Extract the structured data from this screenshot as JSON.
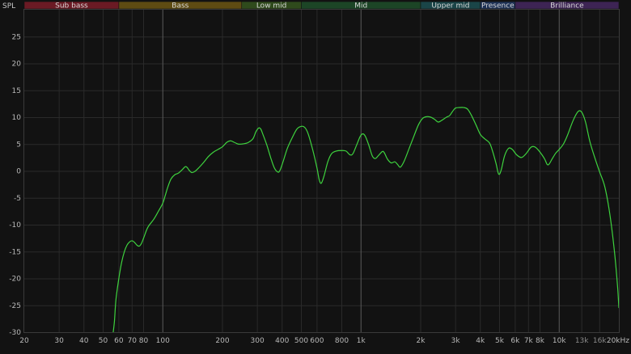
{
  "chart_data": {
    "type": "line",
    "ylabel": "SPL",
    "xscale": "log",
    "xlim": [
      20,
      20000
    ],
    "ylim": [
      -30,
      30
    ],
    "grid": true,
    "colors": {
      "background": "#121212",
      "grid": "#2a2a2a",
      "grid_major": "#5a5a5a",
      "line": "#3ed23e"
    },
    "bands": [
      {
        "name": "Sub bass",
        "from": 20,
        "to": 60,
        "color": "#6b1a24"
      },
      {
        "name": "Bass",
        "from": 60,
        "to": 250,
        "color": "#5e4b12"
      },
      {
        "name": "Low mid",
        "from": 250,
        "to": 500,
        "color": "#2f4a1c"
      },
      {
        "name": "Mid",
        "from": 500,
        "to": 2000,
        "color": "#1c4526"
      },
      {
        "name": "Upper mid",
        "from": 2000,
        "to": 4000,
        "color": "#1a4548"
      },
      {
        "name": "Presence",
        "from": 4000,
        "to": 6000,
        "color": "#1e3256"
      },
      {
        "name": "Brilliance",
        "from": 6000,
        "to": 20000,
        "color": "#3d2454"
      }
    ],
    "y_ticks": [
      {
        "label": "25",
        "value": 25
      },
      {
        "label": "20",
        "value": 20
      },
      {
        "label": "15",
        "value": 15
      },
      {
        "label": "10",
        "value": 10
      },
      {
        "label": "5",
        "value": 5
      },
      {
        "label": "0",
        "value": 0
      },
      {
        "label": "-5",
        "value": -5
      },
      {
        "label": "-10",
        "value": -10
      },
      {
        "label": "-15",
        "value": -15
      },
      {
        "label": "-20",
        "value": -20
      },
      {
        "label": "-25",
        "value": -25
      },
      {
        "label": "-30",
        "value": -30
      }
    ],
    "x_ticks": [
      {
        "label": "20",
        "value": 20,
        "major": false,
        "dim": false
      },
      {
        "label": "30",
        "value": 30,
        "major": false,
        "dim": false
      },
      {
        "label": "40",
        "value": 40,
        "major": false,
        "dim": false
      },
      {
        "label": "50",
        "value": 50,
        "major": false,
        "dim": false
      },
      {
        "label": "60",
        "value": 60,
        "major": false,
        "dim": false
      },
      {
        "label": "70",
        "value": 70,
        "major": false,
        "dim": false
      },
      {
        "label": "80",
        "value": 80,
        "major": false,
        "dim": false
      },
      {
        "label": "100",
        "value": 100,
        "major": true,
        "dim": false
      },
      {
        "label": "200",
        "value": 200,
        "major": false,
        "dim": false
      },
      {
        "label": "300",
        "value": 300,
        "major": false,
        "dim": false
      },
      {
        "label": "400",
        "value": 400,
        "major": false,
        "dim": false
      },
      {
        "label": "500",
        "value": 500,
        "major": false,
        "dim": false
      },
      {
        "label": "600",
        "value": 600,
        "major": false,
        "dim": false
      },
      {
        "label": "800",
        "value": 800,
        "major": false,
        "dim": false
      },
      {
        "label": "1k",
        "value": 1000,
        "major": true,
        "dim": false
      },
      {
        "label": "2k",
        "value": 2000,
        "major": false,
        "dim": false
      },
      {
        "label": "3k",
        "value": 3000,
        "major": false,
        "dim": false
      },
      {
        "label": "4k",
        "value": 4000,
        "major": false,
        "dim": false
      },
      {
        "label": "5k",
        "value": 5000,
        "major": false,
        "dim": false
      },
      {
        "label": "6k",
        "value": 6000,
        "major": false,
        "dim": false
      },
      {
        "label": "7k",
        "value": 7000,
        "major": false,
        "dim": false
      },
      {
        "label": "8k",
        "value": 8000,
        "major": false,
        "dim": false
      },
      {
        "label": "10k",
        "value": 10000,
        "major": true,
        "dim": false
      },
      {
        "label": "13k",
        "value": 13000,
        "major": false,
        "dim": true
      },
      {
        "label": "16k",
        "value": 16000,
        "major": false,
        "dim": true
      },
      {
        "label": "20kHz",
        "value": 20000,
        "major": false,
        "dim": false
      }
    ],
    "series": [
      {
        "points": [
          [
            56,
            -30.5
          ],
          [
            57,
            -28
          ],
          [
            58,
            -24
          ],
          [
            60,
            -20
          ],
          [
            62,
            -17
          ],
          [
            64,
            -15
          ],
          [
            66,
            -13.8
          ],
          [
            68,
            -13.2
          ],
          [
            70,
            -13
          ],
          [
            72,
            -13.3
          ],
          [
            74,
            -13.8
          ],
          [
            76,
            -14
          ],
          [
            78,
            -13.5
          ],
          [
            80,
            -12.5
          ],
          [
            84,
            -10.5
          ],
          [
            90,
            -9
          ],
          [
            95,
            -7.5
          ],
          [
            100,
            -6
          ],
          [
            103,
            -4.5
          ],
          [
            106,
            -3
          ],
          [
            110,
            -1.5
          ],
          [
            115,
            -0.7
          ],
          [
            120,
            -0.4
          ],
          [
            125,
            0.2
          ],
          [
            130,
            0.8
          ],
          [
            133,
            0.6
          ],
          [
            136,
            0.1
          ],
          [
            140,
            -0.3
          ],
          [
            145,
            -0.1
          ],
          [
            152,
            0.6
          ],
          [
            160,
            1.5
          ],
          [
            170,
            2.7
          ],
          [
            180,
            3.5
          ],
          [
            190,
            4
          ],
          [
            200,
            4.5
          ],
          [
            210,
            5.3
          ],
          [
            220,
            5.6
          ],
          [
            230,
            5.3
          ],
          [
            240,
            5
          ],
          [
            250,
            5
          ],
          [
            260,
            5.1
          ],
          [
            270,
            5.3
          ],
          [
            285,
            6
          ],
          [
            295,
            7.3
          ],
          [
            305,
            8
          ],
          [
            312,
            7.8
          ],
          [
            320,
            6.8
          ],
          [
            335,
            4.8
          ],
          [
            350,
            2.5
          ],
          [
            365,
            0.6
          ],
          [
            380,
            -0.2
          ],
          [
            390,
            0.1
          ],
          [
            405,
            1.8
          ],
          [
            425,
            4.2
          ],
          [
            450,
            6.2
          ],
          [
            475,
            7.8
          ],
          [
            500,
            8.3
          ],
          [
            520,
            8.1
          ],
          [
            540,
            7
          ],
          [
            570,
            4
          ],
          [
            600,
            0.5
          ],
          [
            615,
            -1.6
          ],
          [
            630,
            -2.3
          ],
          [
            650,
            -1
          ],
          [
            680,
            1.7
          ],
          [
            710,
            3.2
          ],
          [
            750,
            3.7
          ],
          [
            800,
            3.8
          ],
          [
            840,
            3.7
          ],
          [
            880,
            3
          ],
          [
            910,
            3.2
          ],
          [
            950,
            4.8
          ],
          [
            990,
            6.4
          ],
          [
            1020,
            6.9
          ],
          [
            1050,
            6.5
          ],
          [
            1090,
            5
          ],
          [
            1140,
            2.8
          ],
          [
            1180,
            2.3
          ],
          [
            1220,
            2.8
          ],
          [
            1280,
            3.6
          ],
          [
            1310,
            3.4
          ],
          [
            1360,
            2.2
          ],
          [
            1420,
            1.5
          ],
          [
            1480,
            1.7
          ],
          [
            1530,
            1.2
          ],
          [
            1580,
            0.7
          ],
          [
            1650,
            1.8
          ],
          [
            1750,
            4.2
          ],
          [
            1850,
            6.5
          ],
          [
            1950,
            8.6
          ],
          [
            2050,
            9.8
          ],
          [
            2150,
            10.1
          ],
          [
            2250,
            10
          ],
          [
            2350,
            9.6
          ],
          [
            2450,
            9.1
          ],
          [
            2550,
            9.4
          ],
          [
            2700,
            10
          ],
          [
            2800,
            10.3
          ],
          [
            2900,
            11.1
          ],
          [
            3000,
            11.7
          ],
          [
            3150,
            11.8
          ],
          [
            3300,
            11.8
          ],
          [
            3450,
            11.5
          ],
          [
            3600,
            10.4
          ],
          [
            3800,
            8.6
          ],
          [
            4000,
            6.8
          ],
          [
            4200,
            6
          ],
          [
            4450,
            5.2
          ],
          [
            4600,
            3.8
          ],
          [
            4800,
            1.4
          ],
          [
            4950,
            -0.6
          ],
          [
            5100,
            0.2
          ],
          [
            5300,
            2.8
          ],
          [
            5550,
            4.2
          ],
          [
            5800,
            4
          ],
          [
            6100,
            3
          ],
          [
            6450,
            2.5
          ],
          [
            6800,
            3.2
          ],
          [
            7200,
            4.4
          ],
          [
            7500,
            4.5
          ],
          [
            7800,
            4
          ],
          [
            8150,
            3.1
          ],
          [
            8450,
            2.2
          ],
          [
            8700,
            1.2
          ],
          [
            8900,
            1.3
          ],
          [
            9200,
            2.2
          ],
          [
            9600,
            3.3
          ],
          [
            10000,
            4
          ],
          [
            10500,
            5
          ],
          [
            11000,
            6.6
          ],
          [
            11700,
            9.2
          ],
          [
            12300,
            10.8
          ],
          [
            12700,
            11.2
          ],
          [
            13100,
            10.7
          ],
          [
            13600,
            9
          ],
          [
            14300,
            5.4
          ],
          [
            15200,
            2.2
          ],
          [
            16000,
            -0.2
          ],
          [
            17000,
            -3
          ],
          [
            18000,
            -8
          ],
          [
            19000,
            -15
          ],
          [
            19700,
            -21.5
          ],
          [
            20000,
            -25.5
          ]
        ]
      }
    ]
  }
}
